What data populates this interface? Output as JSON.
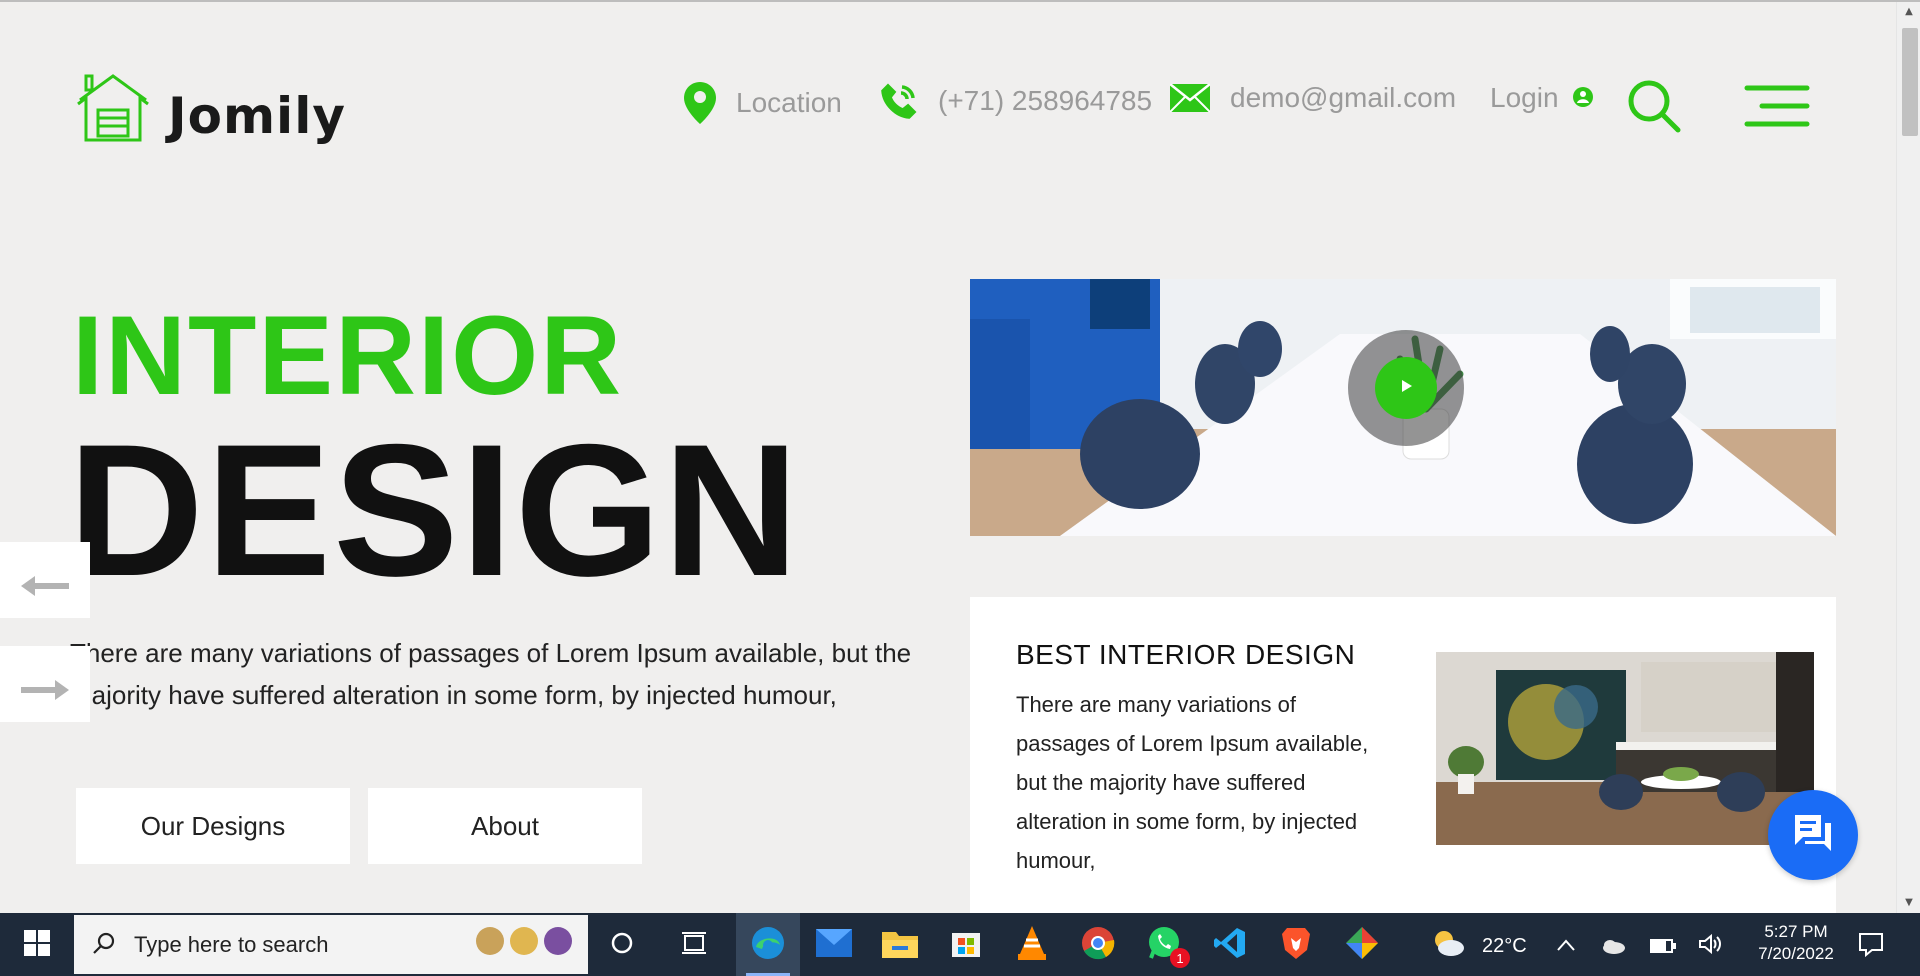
{
  "brand": {
    "name": "Jomily",
    "accent": "#2ec617"
  },
  "header": {
    "location": "Location",
    "phone": "(+71) 258964785",
    "email": "demo@gmail.com",
    "login": "Login"
  },
  "hero": {
    "line1": "INTERIOR",
    "line2": "DESIGN",
    "description": "There are many variations of passages of Lorem Ipsum available, but the majority have suffered alteration in some form, by injected humour,",
    "buttons": {
      "designs": "Our Designs",
      "about": "About"
    }
  },
  "slider": {
    "prev_icon": "arrow-left-icon",
    "next_icon": "arrow-right-icon"
  },
  "card": {
    "title": "BEST INTERIOR DESIGN",
    "text": "There are many variations of passages of Lorem Ipsum available, but the majority have suffered alteration in some form, by injected humour,"
  },
  "taskbar": {
    "search_placeholder": "Type here to search",
    "temperature": "22°C",
    "time": "5:27 PM",
    "date": "7/20/2022",
    "whatsapp_badge": "1"
  }
}
